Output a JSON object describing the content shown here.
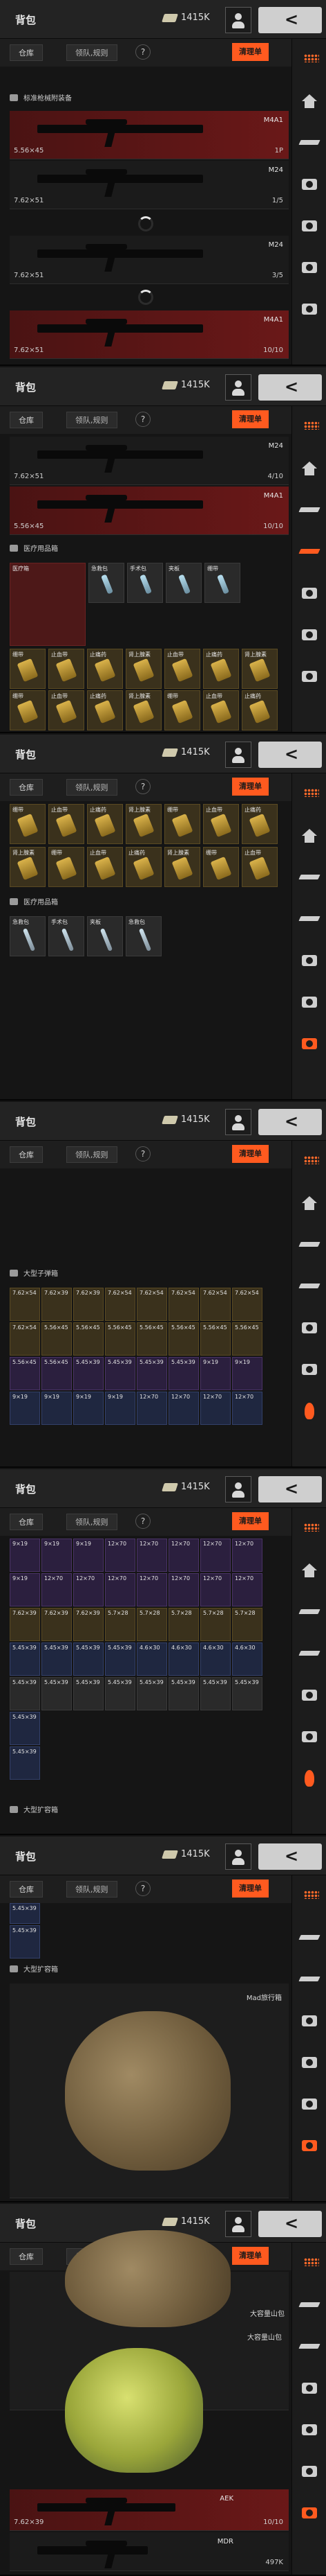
{
  "header": {
    "title": "背包",
    "coins": "1415K",
    "back_icon": "<"
  },
  "tabs": {
    "warehouse": "仓库",
    "team": "领队,规则",
    "help": "?",
    "clean": "清理单"
  },
  "sections": {
    "weapons": "标准枪械附装备",
    "medical": "医疗用品箱",
    "ammo": "大型子弹箱",
    "backpack": "大型扩容箱"
  },
  "weapons": [
    {
      "name": "M4A1",
      "ammo": "5.56×45",
      "count": "1P"
    },
    {
      "name": "M24",
      "ammo": "7.62×51",
      "count": "1/5"
    },
    {
      "name": "M24",
      "ammo": "7.62×51",
      "count": "3/5"
    },
    {
      "name": "M24",
      "ammo": "7.62×51",
      "count": "4/10"
    },
    {
      "name": "M4A1",
      "ammo": "7.62×51",
      "count": "10/10"
    }
  ],
  "medical_items": [
    "绷带",
    "止血带",
    "止痛药",
    "肾上腺素",
    "急救包",
    "手术包",
    "夹板",
    "医疗箱"
  ],
  "ammo_items": [
    "7.62×54",
    "7.62×39",
    "5.56×45",
    "5.45×39",
    "9×19",
    "12×70",
    "5.7×28",
    "4.6×30"
  ],
  "backpack": {
    "name1": "Mad旅行箱",
    "name2": "大容量山包"
  },
  "bottom": {
    "ammo": "7.62×39",
    "gun1": "AEK",
    "gun2": "MDR",
    "price": "497K",
    "count": "10/10"
  }
}
